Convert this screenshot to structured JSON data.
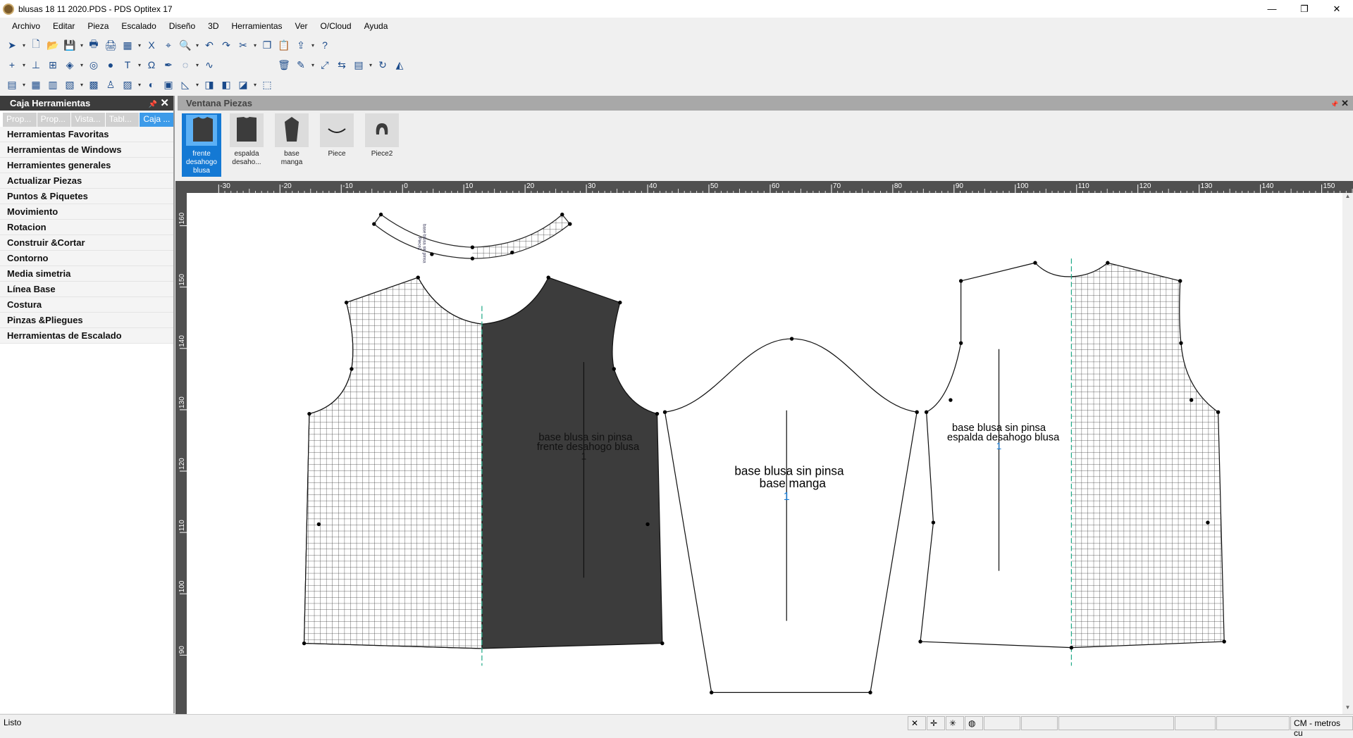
{
  "window": {
    "title": "blusas 18 11 2020.PDS - PDS Optitex 17",
    "minimize": "—",
    "maximize": "❐",
    "close": "✕"
  },
  "menu": [
    "Archivo",
    "Editar",
    "Pieza",
    "Escalado",
    "Diseño",
    "3D",
    "Herramientas",
    "Ver",
    "O/Cloud",
    "Ayuda"
  ],
  "toolbars": [
    [
      [
        "select-arrow-icon",
        "➤"
      ],
      [
        "new-file-icon",
        "🗋"
      ],
      [
        "open-folder-icon",
        "📂"
      ],
      [
        "save-icon",
        "💾"
      ],
      [
        "print-icon",
        "🖶"
      ],
      [
        "plot-icon",
        "🖨"
      ],
      [
        "layout-icon",
        "▦"
      ],
      [
        "excel-icon",
        "X"
      ],
      [
        "tag-icon",
        "⌖"
      ],
      [
        "zoom-icon",
        "🔍"
      ],
      [
        "undo-icon",
        "↶"
      ],
      [
        "redo-icon",
        "↷"
      ],
      [
        "cut-icon",
        "✂"
      ],
      [
        "copy-icon",
        "❐"
      ],
      [
        "paste-icon",
        "📋"
      ],
      [
        "export-icon",
        "⇪"
      ],
      [
        "help-icon",
        "?"
      ]
    ],
    [
      [
        "add-point-icon",
        "+"
      ],
      [
        "add-perpendicular-icon",
        "⊥"
      ],
      [
        "add-notch-icon",
        "⊞"
      ],
      [
        "fold-icon",
        "◈"
      ],
      [
        "circle-icon",
        "◎"
      ],
      [
        "button-icon",
        "●"
      ],
      [
        "text-icon",
        "T"
      ],
      [
        "curve-tool-icon",
        "Ω"
      ],
      [
        "pen-icon",
        "✒"
      ],
      [
        "lasso-icon",
        "◌"
      ],
      [
        "wave-icon",
        "∿"
      ],
      [
        "delete-icon",
        "🗑"
      ],
      [
        "pen-tool-icon",
        "✎"
      ],
      [
        "resize-icon",
        "⤢"
      ],
      [
        "move-icon",
        "⇆"
      ],
      [
        "align-icon",
        "▤"
      ],
      [
        "rotate-icon",
        "↻"
      ],
      [
        "mirror-icon",
        "◭"
      ]
    ],
    [
      [
        "table-icon",
        "▤"
      ],
      [
        "grid-icon",
        "▦"
      ],
      [
        "sheet-icon",
        "▥"
      ],
      [
        "rules-icon",
        "▧"
      ],
      [
        "calculator-icon",
        "▩"
      ],
      [
        "avatar-icon",
        "♙"
      ],
      [
        "fabric-icon",
        "▨"
      ],
      [
        "shapes-icon",
        "◐"
      ],
      [
        "marker-icon",
        "▣"
      ],
      [
        "ruler-square-icon",
        "◺"
      ],
      [
        "piece-a-icon",
        "◨"
      ],
      [
        "piece-b-icon",
        "◧"
      ],
      [
        "piece-c-icon",
        "◪"
      ],
      [
        "piece-outline-icon",
        "⬚"
      ]
    ]
  ],
  "toolbox": {
    "title": "Caja Herramientas",
    "pin": "📌",
    "close": "✕",
    "tabs": [
      "Prop...",
      "Prop...",
      "Vista...",
      "Tabl...",
      "Caja ..."
    ],
    "items": [
      "Herramientas Favoritas",
      "Herramientas de Windows",
      "Herramientes generales",
      "Actualizar Piezas",
      "Puntos & Piquetes",
      "Movimiento",
      "Rotacion",
      "Construir &Cortar",
      "Contorno",
      "Media simetria",
      "Línea Base",
      "Costura",
      "Pinzas &Pliegues",
      "Herramientas de Escalado"
    ]
  },
  "pieces_window": {
    "title": "Ventana Piezas",
    "pin": "📌",
    "close": "✕",
    "pieces": [
      {
        "label": "frente desahogo blusa",
        "selected": true
      },
      {
        "label": "espalda desaho...",
        "selected": false
      },
      {
        "label": "base manga",
        "selected": false
      },
      {
        "label": "Piece",
        "selected": false
      },
      {
        "label": "Piece2",
        "selected": false
      }
    ]
  },
  "ruler": {
    "h": [
      "-30",
      "-20",
      "-10",
      "0",
      "10",
      "20",
      "30",
      "40",
      "50",
      "60",
      "70",
      "80",
      "90",
      "100",
      "110",
      "120",
      "130",
      "140",
      "150"
    ],
    "v": [
      "160",
      "150",
      "140",
      "130",
      "120",
      "110",
      "100",
      "90"
    ]
  },
  "canvas": {
    "front": {
      "line1": "base blusa sin pinsa",
      "line2": "frente desahogo blusa",
      "qty": "1"
    },
    "sleeve": {
      "line1": "base blusa sin pinsa",
      "line2": "base manga",
      "qty": "1"
    },
    "back": {
      "line1": "base blusa sin pinsa",
      "line2": "espalda desahogo blusa",
      "qty": "1"
    },
    "neck": {
      "line1": "base blusa sin pinsa",
      "line2": "Piece2"
    }
  },
  "colors": {
    "piece_dark": "#3c3c3c",
    "selection": "#1479d4",
    "panel_header": "#3c3c3c"
  },
  "status": {
    "text": "Listo",
    "units": "CM - metros cu"
  }
}
